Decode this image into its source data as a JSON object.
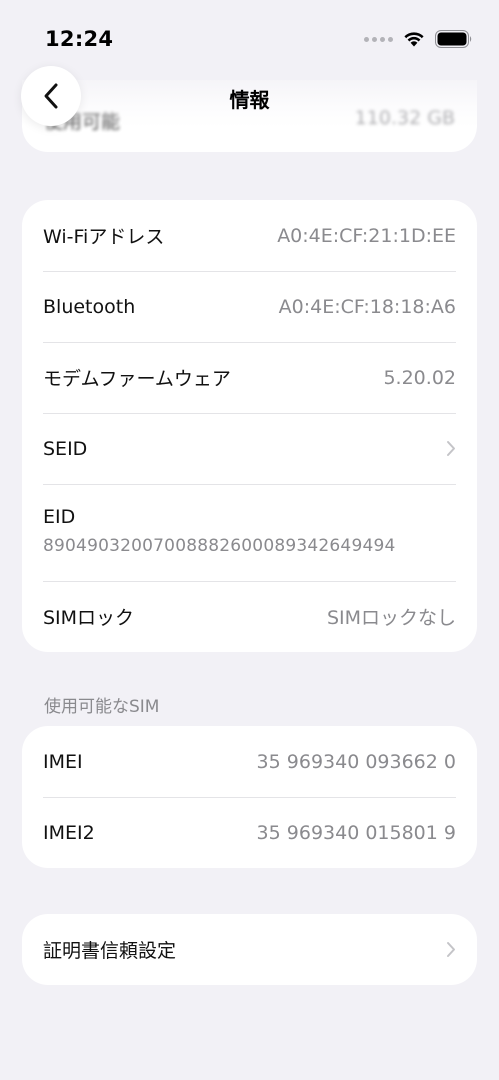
{
  "status_bar": {
    "time": "12:24",
    "icons": [
      "signal-dots-icon",
      "wifi-icon",
      "battery-icon"
    ]
  },
  "nav": {
    "title": "情報",
    "back_icon": "chevron-left-icon"
  },
  "top_card": {
    "label": "使用可能",
    "value": "110.32 GB"
  },
  "network_card": {
    "wifi": {
      "label": "Wi-Fiアドレス",
      "value": "A0:4E:CF:21:1D:EE"
    },
    "bluetooth": {
      "label": "Bluetooth",
      "value": "A0:4E:CF:18:18:A6"
    },
    "modem": {
      "label": "モデムファームウェア",
      "value": "5.20.02"
    },
    "seid": {
      "label": "SEID"
    },
    "eid": {
      "label": "EID",
      "value": "89049032007008882600089342649494"
    },
    "sim_lock": {
      "label": "SIMロック",
      "value": "SIMロックなし"
    }
  },
  "sim_section": {
    "header": "使用可能なSIM",
    "imei": {
      "label": "IMEI",
      "value": "35 969340 093662 0"
    },
    "imei2": {
      "label": "IMEI2",
      "value": "35 969340 015801 9"
    }
  },
  "cert_card": {
    "label": "証明書信頼設定"
  },
  "colors": {
    "background": "#f2f1f6",
    "card": "#ffffff",
    "secondary_text": "#8a8a8e",
    "separator": "#e4e4e7",
    "chevron": "#c4c4c8"
  }
}
